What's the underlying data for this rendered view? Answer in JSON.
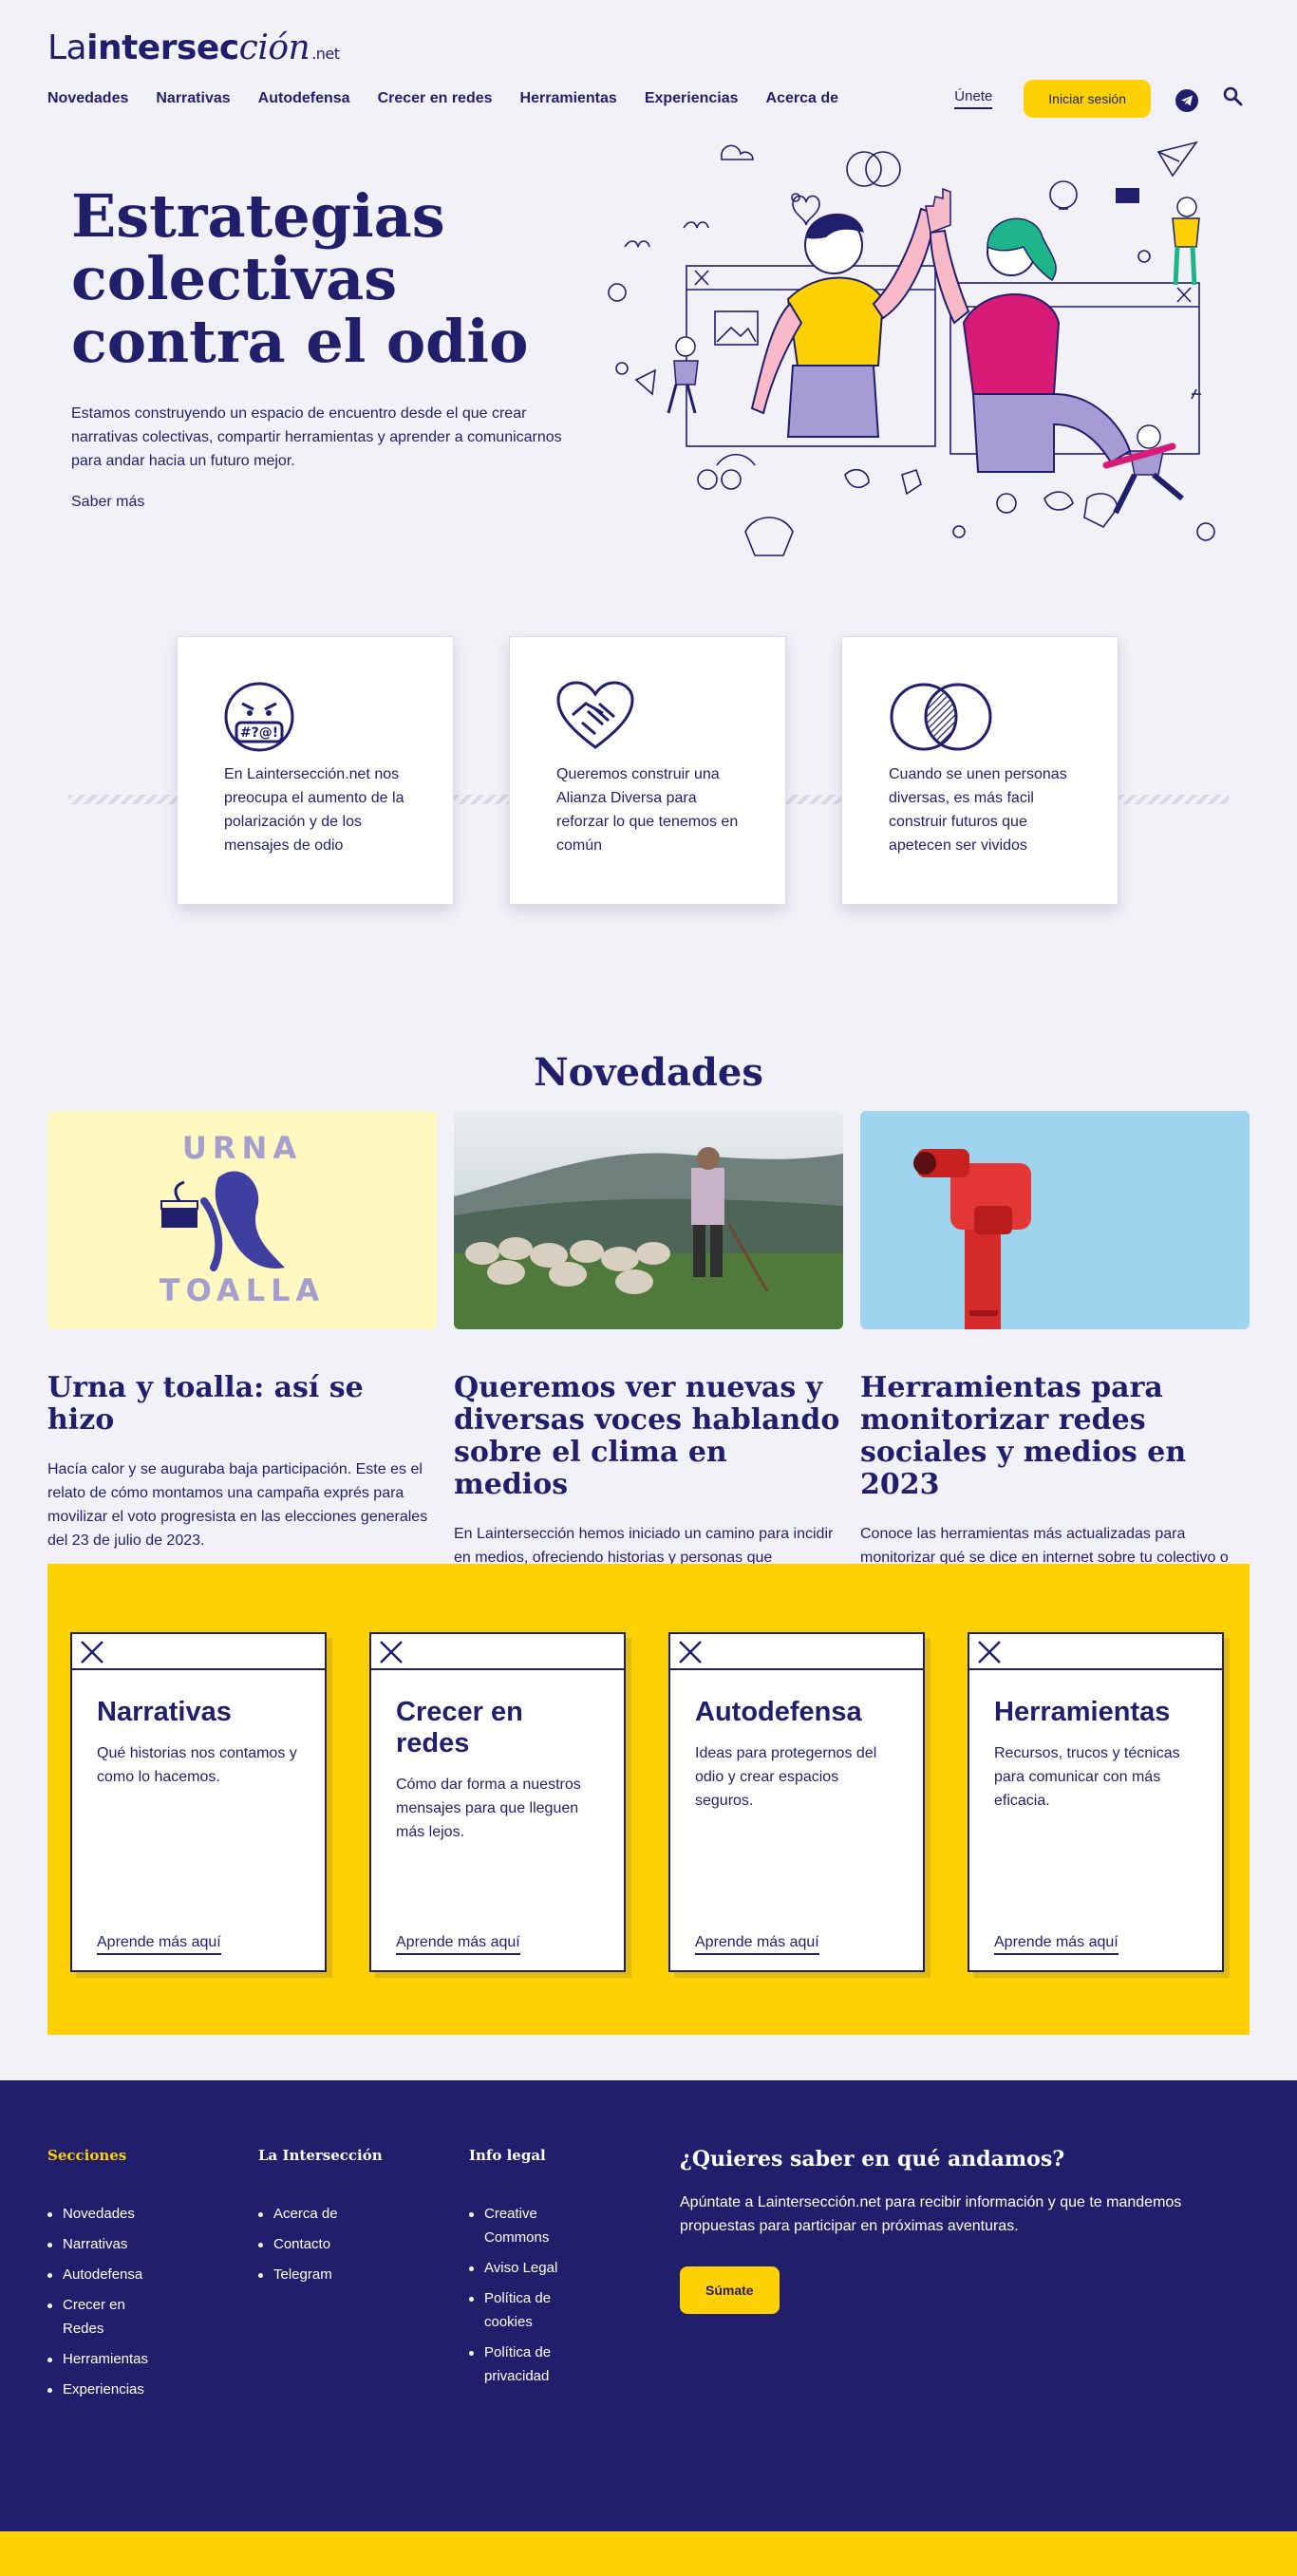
{
  "header": {
    "logo": {
      "part1": "La",
      "part2": "intersec",
      "part3": "ción",
      "part4": ".net"
    },
    "nav": [
      "Novedades",
      "Narrativas",
      "Autodefensa",
      "Crecer en redes",
      "Herramientas",
      "Experiencias",
      "Acerca de"
    ],
    "join_label": "Únete",
    "login_label": "Iniciar sesión"
  },
  "hero": {
    "title": "Estrategias colectivas contra el odio",
    "text": "Estamos construyendo un espacio de encuentro desde el que crear narrativas colectivas, compartir herramientas y aprender a comunicarnos para andar hacia un futuro mejor.",
    "link": "Saber más"
  },
  "features": [
    {
      "icon": "angry-face-icon",
      "text": "En Laintersección.net nos preocupa el aumento de la polarización y de los mensajes de odio"
    },
    {
      "icon": "heart-handshake-icon",
      "text": "Queremos construir una Alianza Diversa para reforzar lo que tenemos en común"
    },
    {
      "icon": "overlapping-circles-icon",
      "text": "Cuando se unen personas diversas, es más facil construir futuros que apetecen ser vividos"
    }
  ],
  "novedades": {
    "title": "Novedades",
    "items": [
      {
        "image_text_top": "URNA",
        "image_text_bottom": "TOALLA",
        "title": "Urna y toalla: así se hizo",
        "text": "Hacía calor y se auguraba baja participación. Este es el relato de cómo montamos una campaña exprés para movilizar el voto progresista en las elecciones generales del 23 de julio de 2023."
      },
      {
        "title": "Queremos ver nuevas y diversas voces hablando sobre el clima en medios",
        "text": "En Laintersección hemos iniciado un camino para incidir en medios, ofreciendo historias y personas que normalmente no caben en la escaleta, para diversificar las voces que oímos en nuestro día a día."
      },
      {
        "title": "Herramientas para monitorizar redes sociales y medios en 2023",
        "text": "Conoce las herramientas más actualizadas para monitorizar qué se dice en internet sobre tu colectivo o sobre los asuntos que te interesan."
      }
    ]
  },
  "sections": [
    {
      "title": "Narrativas",
      "text": "Qué historias nos contamos y como lo hacemos.",
      "link": "Aprende más aquí"
    },
    {
      "title": "Crecer en redes",
      "text": "Cómo dar forma a nuestros mensajes para que lleguen más lejos.",
      "link": "Aprende más aquí"
    },
    {
      "title": "Autodefensa",
      "text": "Ideas para protegernos del odio y crear espacios seguros.",
      "link": "Aprende más aquí"
    },
    {
      "title": "Herramientas",
      "text": "Recursos, trucos y técnicas para comunicar con más eficacia.",
      "link": "Aprende más aquí"
    }
  ],
  "footer": {
    "col1": {
      "title": "Secciones",
      "items": [
        "Novedades",
        "Narrativas",
        "Autodefensa",
        "Crecer en Redes",
        "Herramientas",
        "Experiencias"
      ]
    },
    "col2": {
      "title": "La Intersección",
      "items": [
        "Acerca de",
        "Contacto",
        "Telegram"
      ]
    },
    "col3": {
      "title": "Info legal",
      "items": [
        "Creative Commons",
        "Aviso Legal",
        "Política de cookies",
        "Política de privacidad"
      ]
    },
    "newsletter": {
      "title": "¿Quieres saber en qué andamos?",
      "text": "Apúntate a Laintersección.net para recibir información y que te mandemos propuestas para participar en próximas aventuras.",
      "button": "Súmate"
    }
  },
  "colors": {
    "navy": "#211f6c",
    "yellow": "#fdd104",
    "background": "#f2f1f8"
  }
}
